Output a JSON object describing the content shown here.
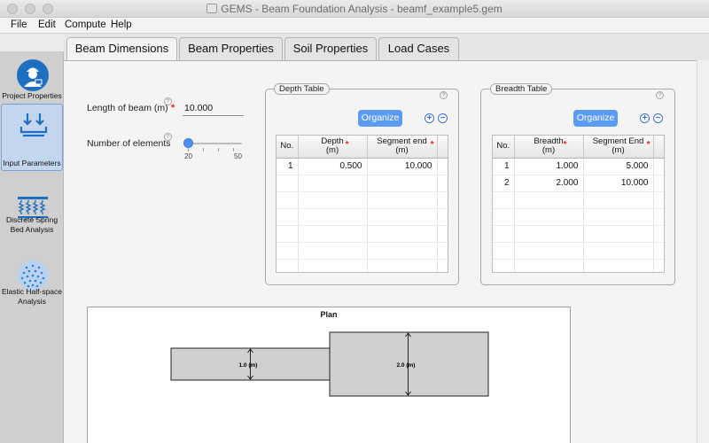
{
  "window": {
    "title": "GEMS - Beam Foundation Analysis - beamf_example5.gem"
  },
  "menu": [
    "File",
    "Edit",
    "Compute",
    "Help"
  ],
  "sidebar": {
    "items": [
      {
        "label": "Project Properties",
        "icon": "engineer-icon"
      },
      {
        "label": "Input Parameters",
        "icon": "input-parameters-icon",
        "active": true
      },
      {
        "label": "Discrete Spring Bed Analysis",
        "icon": "spring-bed-icon"
      },
      {
        "label": "Elastic Half-space Analysis",
        "icon": "half-space-icon"
      }
    ]
  },
  "tabs": [
    {
      "label": "Beam Dimensions",
      "active": true
    },
    {
      "label": "Beam Properties"
    },
    {
      "label": "Soil Properties"
    },
    {
      "label": "Load Cases"
    }
  ],
  "form": {
    "length_label": "Length of beam (m)",
    "length_value": "10.000",
    "elements_label": "Number of elements",
    "slider_min": "20",
    "slider_max": "50",
    "slider_value": 20
  },
  "help_glyph": "?",
  "required_mark": "*",
  "organize_label": "Organize",
  "add_glyph": "+",
  "remove_glyph": "−",
  "depth_table": {
    "title": "Depth Table",
    "headers": [
      "No.",
      "Depth\n(m)",
      "Segment end\n(m)"
    ],
    "rows": [
      {
        "no": "1",
        "depth": "0.500",
        "end": "10.000"
      }
    ]
  },
  "breadth_table": {
    "title": "Breadth Table",
    "headers": [
      "No.",
      "Breadth\n(m)",
      "Segment End\n(m)"
    ],
    "rows": [
      {
        "no": "1",
        "breadth": "1.000",
        "end": "5.000"
      },
      {
        "no": "2",
        "breadth": "2.000",
        "end": "10.000"
      }
    ]
  },
  "plan": {
    "title": "Plan",
    "segments": [
      {
        "width_label": "1.0 (m)",
        "breadth": 1.0,
        "start": 0,
        "end": 5
      },
      {
        "width_label": "2.0 (m)",
        "breadth": 2.0,
        "start": 5,
        "end": 10
      }
    ]
  },
  "colors": {
    "accent": "#5b9bf3",
    "required": "#e0262a",
    "plan_fill": "#d0d0d0"
  }
}
